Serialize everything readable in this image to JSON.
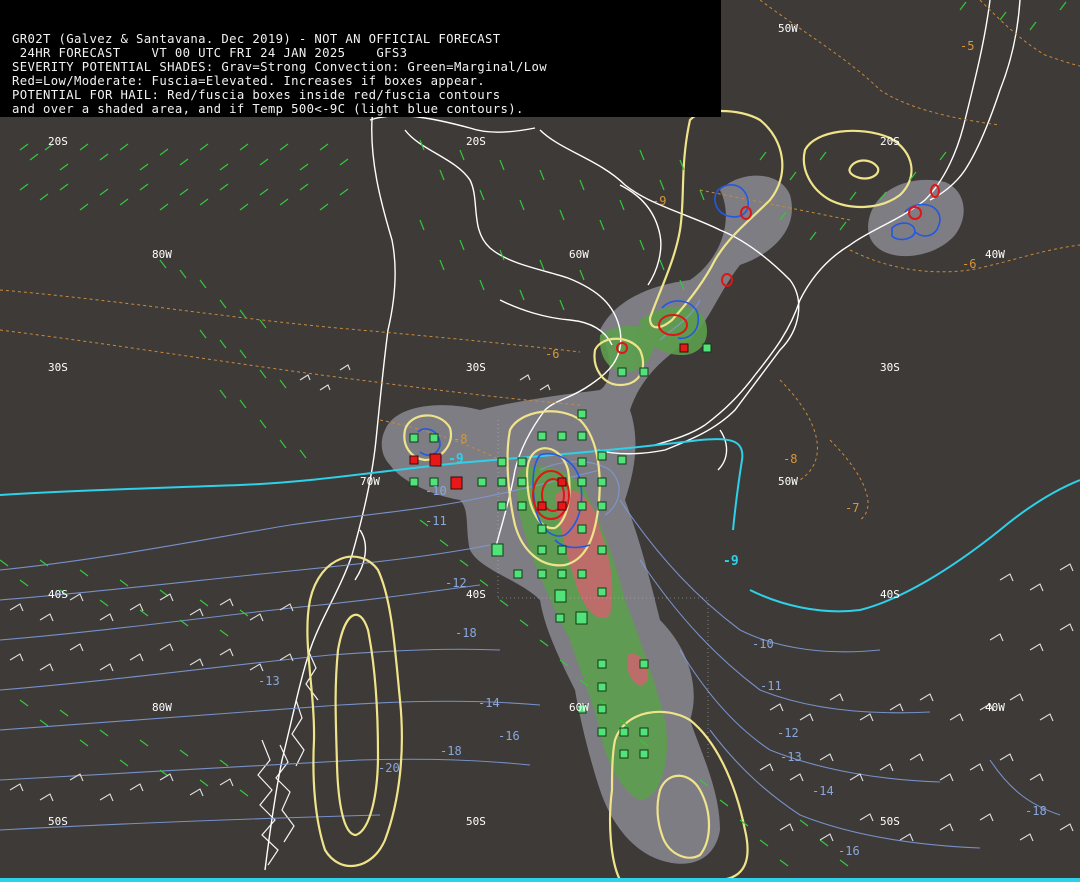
{
  "header": {
    "line1": "GR02T (Galvez & Santavana. Dec 2019) - NOT AN OFFICIAL FORECAST",
    "line2": " 24HR FORECAST    VT 00 UTC FRI 24 JAN 2025    GFS3",
    "line3": "SEVERITY POTENTIAL SHADES: Grav=Strong Convection: Green=Marginal/Low",
    "line4": "Red=Low/Moderate: Fuscia=Elevated. Increases if boxes appear.",
    "line5": "POTENTIAL FOR HAIL: Red/fuscia boxes inside red/fuscia contours",
    "line6": "and over a shaded area, and if Temp 500<-9C (light blue contours)."
  },
  "grid_labels": {
    "lat_20s_w": "20S",
    "lat_20s_c": "20S",
    "lat_20s_e": "20S",
    "lat_30s_w": "30S",
    "lat_30s_c": "30S",
    "lat_30s_e": "30S",
    "lat_40s_w": "40S",
    "lat_40s_c": "40S",
    "lat_40s_e": "40S",
    "lat_50s_w": "50S",
    "lat_50s_c": "50S",
    "lat_50s_e": "50S",
    "lon_50w_n": "50W",
    "lon_80w_n": "80W",
    "lon_60w_n": "60W",
    "lon_40w_n": "40W",
    "lon_70w_c": "70W",
    "lon_50w_c": "50W",
    "lon_80w_s": "80W",
    "lon_60w_s": "60W",
    "lon_40w_s": "40W"
  },
  "contour_labels": {
    "o_m5": "-5",
    "o_m6a": "-6",
    "o_m6b": "-6",
    "o_m7": "-7",
    "o_m8a": "-8",
    "o_m8b": "-8",
    "o_m9": "-9",
    "c_m9a": "-9",
    "c_m9b": "-9",
    "b_m10a": "-10",
    "b_m10b": "-10",
    "b_m11a": "-11",
    "b_m11b": "-11",
    "b_m12a": "-12",
    "b_m12b": "-12",
    "b_m13": "-13",
    "b_m14a": "-14",
    "b_m14b": "-14",
    "b_m16a": "-16",
    "b_m16b": "-16",
    "b_m18a": "-18",
    "b_m18b": "-18",
    "b_m18c": "-18",
    "b_m20": "-20",
    "b_m13w": "-13"
  },
  "colors": {
    "background": "#3d3a37",
    "strong_convection": "#8a8a90",
    "marginal": "#5c9e4c",
    "low_moderate": "#c26a6a",
    "temp500_contour": "#2fd0ea",
    "temp_contour_blue": "#7e9ad8",
    "temp_contour_orange": "#c98a3a",
    "yellow_contour": "#efe48a",
    "wind_barbs": "#34c83a",
    "coast": "#ffffff",
    "box_green": "#52e27a",
    "box_red": "#e81818"
  }
}
